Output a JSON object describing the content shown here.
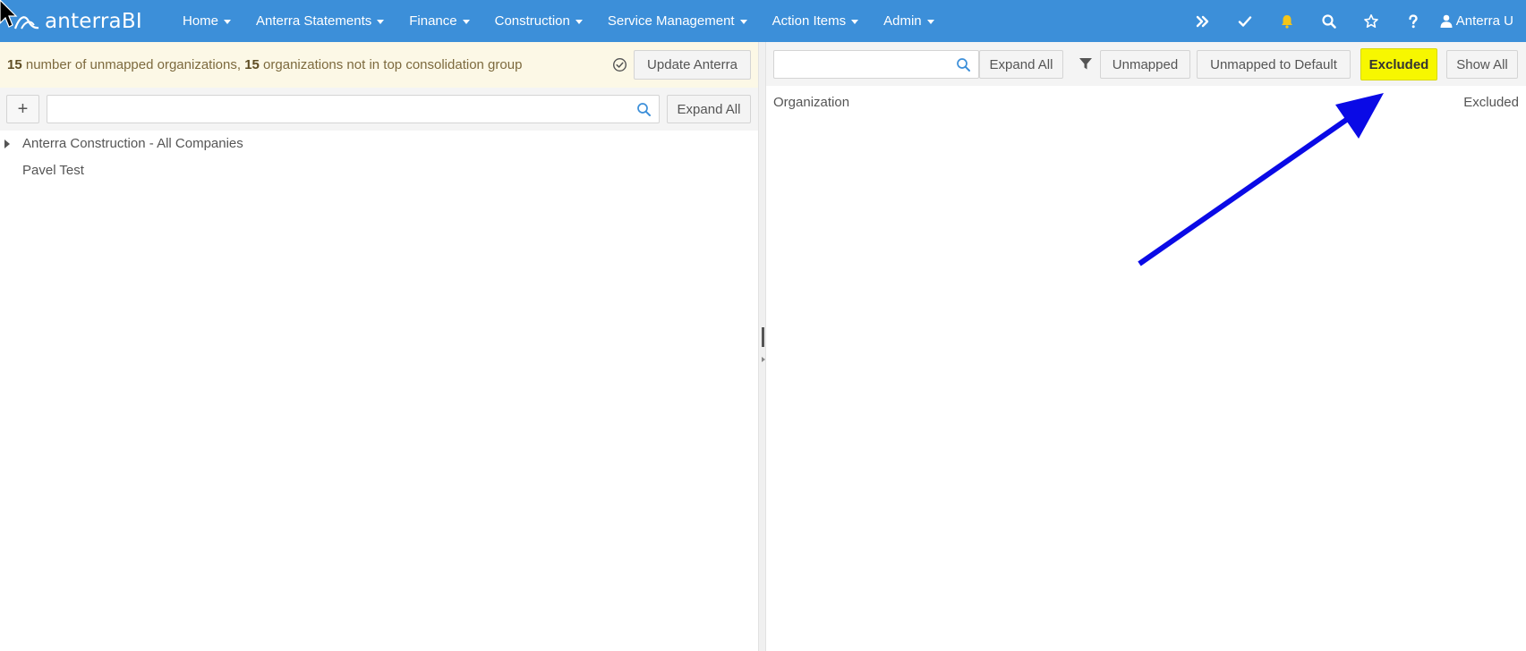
{
  "nav": {
    "brand": "anterraBI",
    "menu": [
      {
        "label": "Home"
      },
      {
        "label": "Anterra Statements"
      },
      {
        "label": "Finance"
      },
      {
        "label": "Construction"
      },
      {
        "label": "Service Management"
      },
      {
        "label": "Action Items"
      },
      {
        "label": "Admin"
      }
    ],
    "icons": [
      "double-chevron-right-icon",
      "checkmark-icon",
      "bell-icon",
      "search-icon",
      "star-icon",
      "question-icon"
    ],
    "user": "Anterra U",
    "bell_color": "#f5c518"
  },
  "notice": {
    "count1": "15",
    "text1": " number of unmapped organizations, ",
    "count2": "15",
    "text2": " organizations not in top consolidation group",
    "update_button": "Update Anterra"
  },
  "left": {
    "add_label": "+",
    "search_placeholder": "",
    "expand_all": "Expand All",
    "tree": [
      {
        "label": "Anterra Construction - All Companies",
        "expandable": true
      },
      {
        "label": "Pavel Test",
        "expandable": false
      }
    ]
  },
  "right": {
    "search_placeholder": "",
    "expand_all": "Expand All",
    "filters": {
      "unmapped": "Unmapped",
      "unmapped_default": "Unmapped to Default",
      "excluded": "Excluded",
      "show_all": "Show All"
    },
    "columns": {
      "organization": "Organization",
      "excluded": "Excluded"
    }
  },
  "colors": {
    "navbar": "#3c8fd9",
    "notice_bg": "#fcf8e6",
    "highlight": "#f7f700",
    "arrow": "#0a0ae6"
  }
}
